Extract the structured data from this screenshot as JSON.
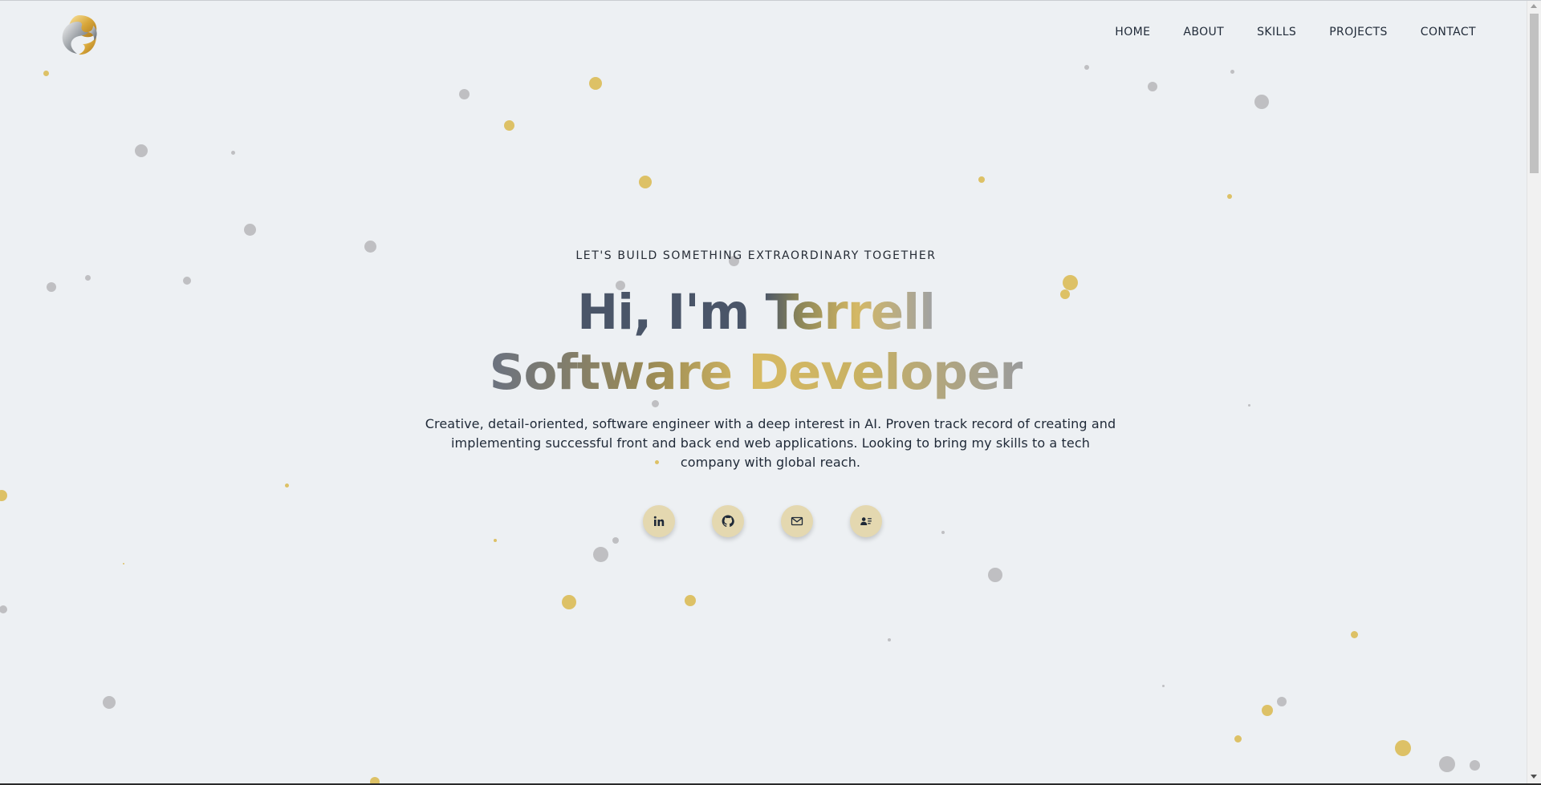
{
  "nav": {
    "items": [
      "HOME",
      "ABOUT",
      "SKILLS",
      "PROJECTS",
      "CONTACT"
    ]
  },
  "hero": {
    "eyebrow": "LET'S BUILD SOMETHING EXTRAORDINARY TOGETHER",
    "headline_line1": "Hi, I'm Terrell",
    "headline_line2": "Software Developer",
    "description": "Creative, detail-oriented, software engineer with a deep interest in AI. Proven track record of creating and implementing successful front and back end web applications. Looking to bring my skills to a tech company with global reach."
  },
  "socials": [
    {
      "name": "linkedin-icon"
    },
    {
      "name": "github-icon"
    },
    {
      "name": "mail-icon"
    },
    {
      "name": "contact-card-icon"
    }
  ],
  "colors": {
    "background": "#edf0f3",
    "gold": "#d9b84c",
    "gray": "#b6b6b8",
    "text": "#1f2937",
    "social_button": "#e4d8b0"
  }
}
